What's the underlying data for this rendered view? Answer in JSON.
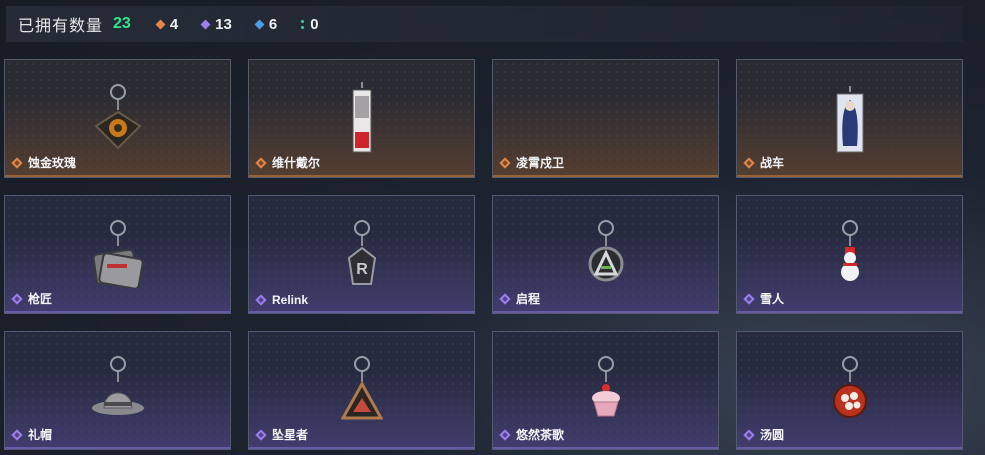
{
  "header": {
    "title": "已拥有数量",
    "total": "23",
    "stats": [
      {
        "icon": "orange-diamond-icon",
        "color": "#e2874a",
        "value": "4"
      },
      {
        "icon": "purple-diamond-icon",
        "color": "#9b7ef0",
        "value": "13"
      },
      {
        "icon": "blue-diamond-icon",
        "color": "#4aa0e6",
        "value": "6"
      },
      {
        "icon": "green-dots-icon",
        "color": "#3ad0a0",
        "value": "0"
      }
    ]
  },
  "items": [
    {
      "name": "蚀金玫瑰",
      "rarity": "orange",
      "charm": "rose-charm-icon"
    },
    {
      "name": "维什戴尔",
      "rarity": "orange",
      "charm": "card-charm-icon"
    },
    {
      "name": "凌霄戍卫",
      "rarity": "orange",
      "charm": ""
    },
    {
      "name": "战车",
      "rarity": "orange",
      "charm": "figure-charm-icon"
    },
    {
      "name": "枪匠",
      "rarity": "purple",
      "charm": "dogtag-charm-icon"
    },
    {
      "name": "Relink",
      "rarity": "purple",
      "charm": "r-emblem-charm-icon"
    },
    {
      "name": "启程",
      "rarity": "purple",
      "charm": "a-medal-charm-icon"
    },
    {
      "name": "雪人",
      "rarity": "purple",
      "charm": "snowman-charm-icon"
    },
    {
      "name": "礼帽",
      "rarity": "purple",
      "charm": "hat-charm-icon"
    },
    {
      "name": "坠星者",
      "rarity": "purple",
      "charm": "triangle-charm-icon"
    },
    {
      "name": "悠然茶歌",
      "rarity": "purple",
      "charm": "cupcake-charm-icon"
    },
    {
      "name": "汤圆",
      "rarity": "purple",
      "charm": "tangyuan-charm-icon"
    }
  ]
}
